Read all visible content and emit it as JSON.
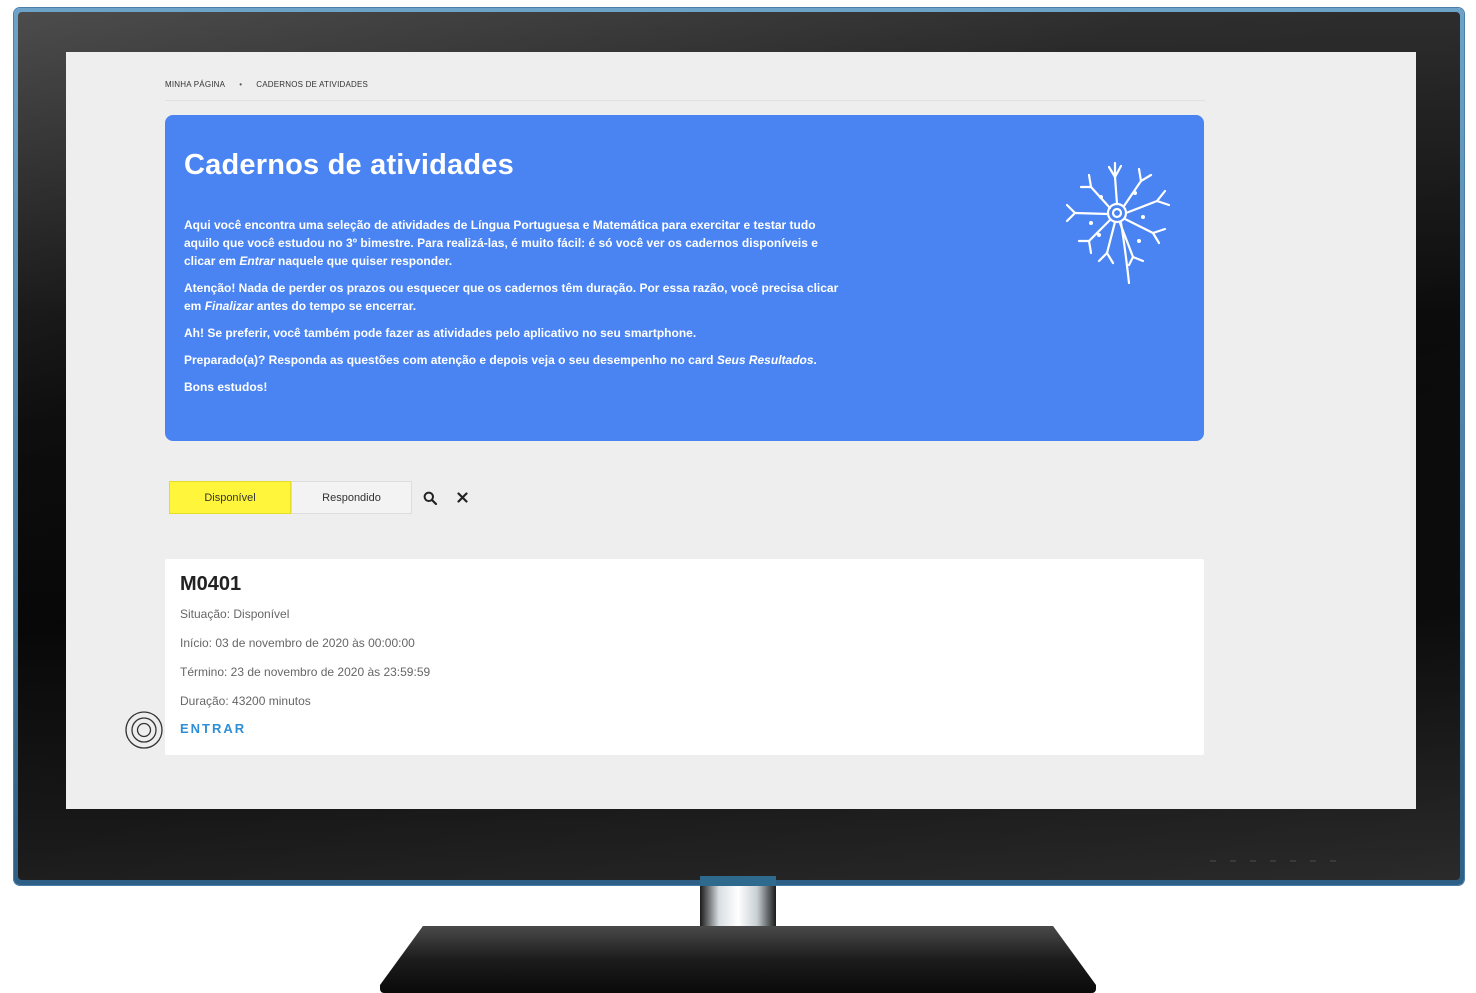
{
  "breadcrumb": {
    "home": "MINHA PÁGINA",
    "separator": "•",
    "current": "CADERNOS DE ATIVIDADES"
  },
  "hero": {
    "title": "Cadernos de atividades",
    "p1_a": "Aqui você encontra uma seleção de atividades de Língua Portuguesa e Matemática para exercitar e testar tudo aquilo que você estudou no 3º bimestre. Para realizá-las, é muito fácil: é só você ver os cadernos disponíveis e clicar em ",
    "p1_em": "Entrar",
    "p1_b": " naquele que quiser responder.",
    "p2_a": "Atenção! Nada de perder os prazos ou esquecer que os cadernos têm duração. Por essa razão, você precisa clicar em ",
    "p2_em": "Finalizar",
    "p2_b": " antes do tempo se encerrar.",
    "p3": "Ah! Se preferir, você também pode fazer as atividades pelo aplicativo no seu smartphone.",
    "p4_a": "Preparado(a)? Responda as questões com atenção e depois veja o seu desempenho no card ",
    "p4_em": "Seus Resultados",
    "p4_b": ".",
    "p5": "Bons estudos!",
    "art_icon": "dandelion-icon",
    "color": "#4a84f2"
  },
  "tabs": {
    "available": "Disponível",
    "answered": "Respondido",
    "active_color": "#fff53a",
    "search_icon": "search-icon",
    "clear_icon": "close-icon"
  },
  "card": {
    "title": "M0401",
    "status": "Situação: Disponível",
    "start": "Início: 03 de novembro de 2020 às 00:00:00",
    "end": "Término: 23 de novembro de 2020 às 23:59:59",
    "duration": "Duração: 43200 minutos",
    "enter": "ENTRAR",
    "link_color": "#2f8ed6"
  },
  "touch_icon": "tap-target-icon"
}
